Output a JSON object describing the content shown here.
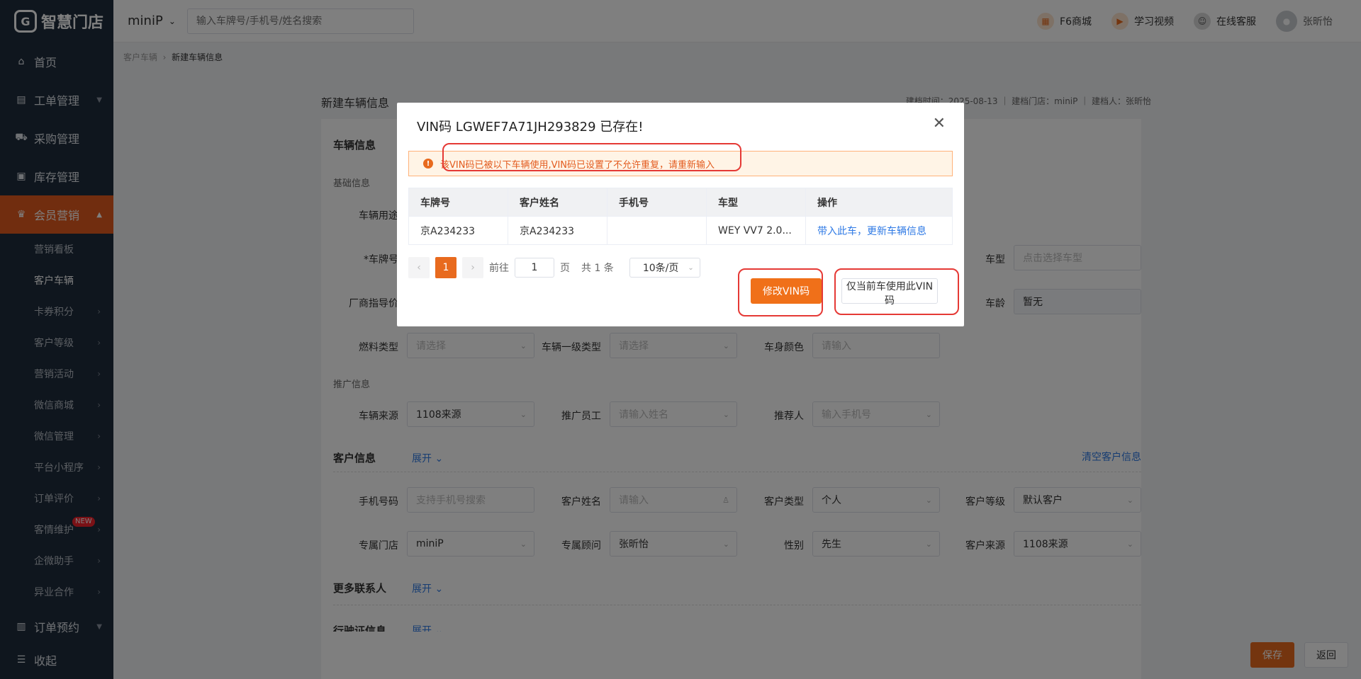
{
  "brand": {
    "logo_text": "智慧门店",
    "logo_mark": "G"
  },
  "topbar": {
    "store_name": "miniP",
    "search_placeholder": "输入车牌号/手机号/姓名搜索",
    "mall": "F6商城",
    "video": "学习视频",
    "service": "在线客服",
    "user": "张昕怡"
  },
  "sidebar": {
    "home": "首页",
    "work_order": "工单管理",
    "purchase": "采购管理",
    "inventory": "库存管理",
    "member": "会员营销",
    "sub": [
      "营销看板",
      "客户车辆",
      "卡券积分",
      "客户等级",
      "营销活动",
      "微信商城",
      "微信管理",
      "平台小程序",
      "订单评价",
      "客情维护",
      "企微助手",
      "异业合作"
    ],
    "new_badge": "NEW",
    "appointment": "订单预约",
    "collapse": "收起"
  },
  "breadcrumb": {
    "parent": "客户车辆",
    "current": "新建车辆信息"
  },
  "page": {
    "title": "新建车辆信息",
    "meta": "建档时间：2025-08-13 ｜ 建档门店：miniP ｜ 建档人：张昕怡"
  },
  "form": {
    "vehicle_info": "车辆信息",
    "basic_info": "基础信息",
    "vehicle_use": "车辆用途",
    "plate": "*车牌号",
    "car_model": "车型",
    "car_model_ph": "点击选择车型",
    "msrp": "厂商指导价",
    "car_age": "车龄",
    "car_age_val": "暂无",
    "fuel": "燃料类型",
    "fuel_ph": "请选择",
    "type1": "车辆一级类型",
    "type1_ph": "请选择",
    "body_color": "车身颜色",
    "body_color_ph": "请输入",
    "promo_info": "推广信息",
    "source": "车辆来源",
    "source_val": "1108来源",
    "promoter": "推广员工",
    "promoter_ph": "请输入姓名",
    "referrer": "推荐人",
    "referrer_ph": "输入手机号",
    "customer_info": "客户信息",
    "expand": "展开",
    "clear_customer": "清空客户信息",
    "phone": "手机号码",
    "phone_ph": "支持手机号搜索",
    "cust_name": "客户姓名",
    "cust_name_ph": "请输入",
    "cust_type": "客户类型",
    "cust_type_val": "个人",
    "cust_level": "客户等级",
    "cust_level_val": "默认客户",
    "store": "专属门店",
    "store_val": "miniP",
    "advisor": "专属顾问",
    "advisor_val": "张昕怡",
    "gender": "性别",
    "gender_val": "先生",
    "cust_source": "客户来源",
    "cust_source_val": "1108来源",
    "more_contacts": "更多联系人",
    "license": "行驶证信息"
  },
  "actions": {
    "save": "保存",
    "back": "返回"
  },
  "modal": {
    "title": "VIN码 LGWEF7A71JH293829 已存在!",
    "warning": "该VIN码已被以下车辆使用,VIN码已设置了不允许重复，请重新输入",
    "columns": [
      "车牌号",
      "客户姓名",
      "手机号",
      "车型",
      "操作"
    ],
    "rows": [
      [
        "京A234233",
        "京A234233",
        "",
        "WEY VV7 2.0...",
        "带入此车，更新车辆信息"
      ]
    ],
    "pager": {
      "current": "1",
      "goto": "前往",
      "goto_val": "1",
      "page": "页",
      "total": "共 1 条",
      "size": "10条/页"
    },
    "btn_modify": "修改VIN码",
    "btn_use": "仅当前车使用此VIN码"
  }
}
